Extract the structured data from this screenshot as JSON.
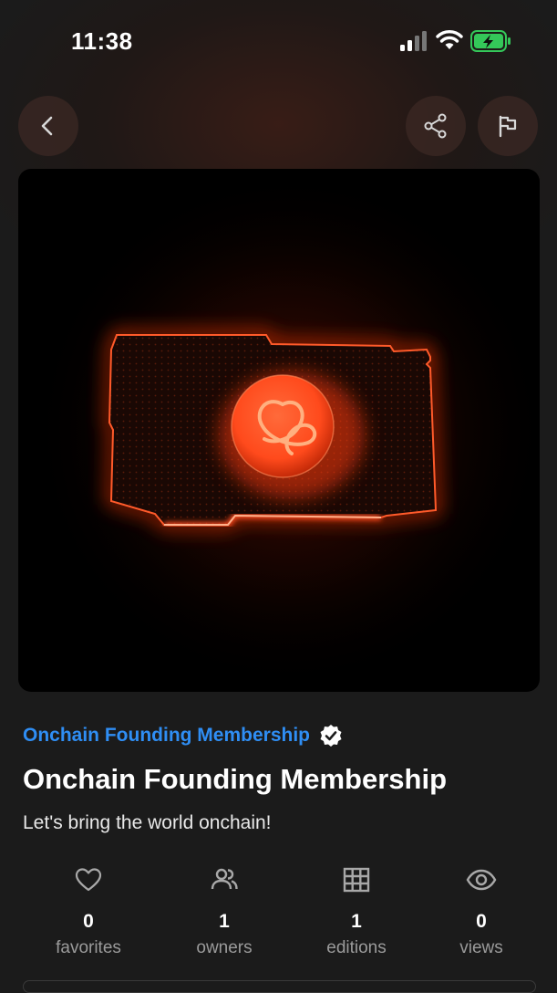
{
  "status_bar": {
    "time": "11:38",
    "battery_color": "#34c759"
  },
  "header": {
    "back_icon": "chevron-left-icon",
    "share_icon": "share-icon",
    "flag_icon": "flag-icon"
  },
  "media": {
    "accent_color": "#ff4a1c"
  },
  "nft": {
    "collection_name": "Onchain Founding Membership",
    "collection_color": "#2f8ef4",
    "title": "Onchain Founding Membership",
    "description": "Let's bring the world onchain!"
  },
  "stats": [
    {
      "icon": "heart-icon",
      "value": "0",
      "label": "favorites"
    },
    {
      "icon": "users-icon",
      "value": "1",
      "label": "owners"
    },
    {
      "icon": "grid-icon",
      "value": "1",
      "label": "editions"
    },
    {
      "icon": "eye-icon",
      "value": "0",
      "label": "views"
    }
  ]
}
